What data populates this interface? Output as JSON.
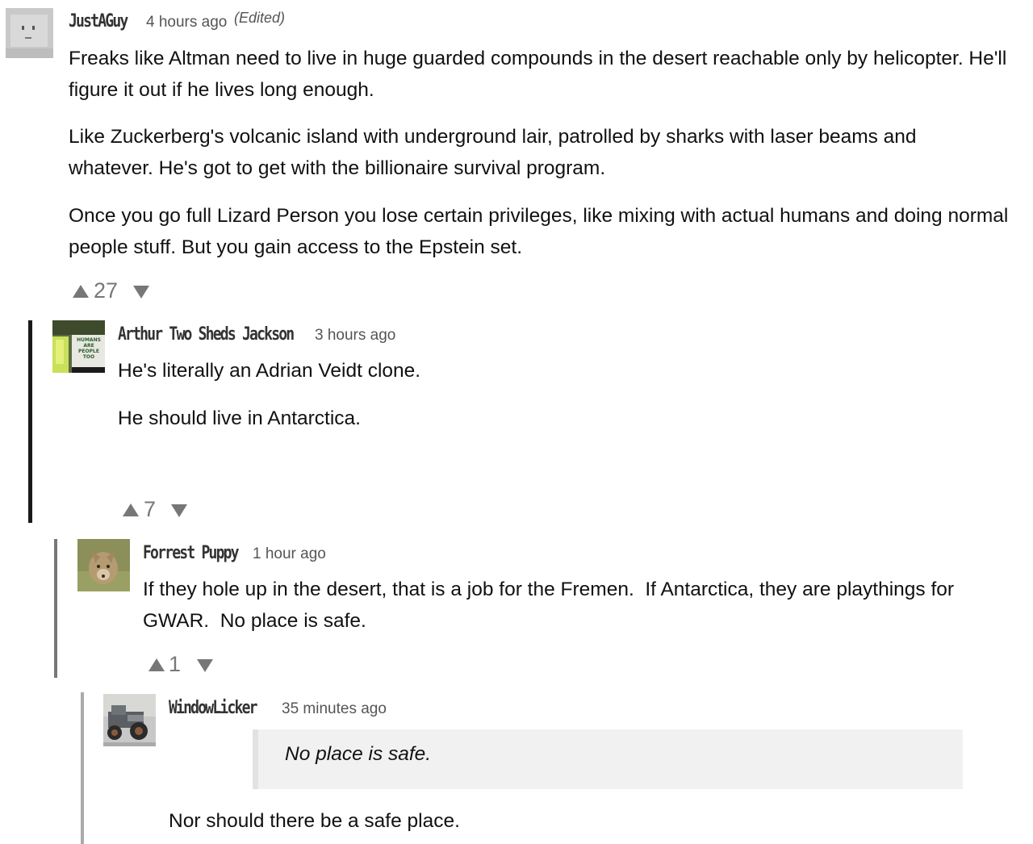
{
  "comments": [
    {
      "username": "JustAGuy",
      "timestamp": "4 hours ago",
      "edited": "(Edited)",
      "avatar_icon": "blocky-robot-avatar-icon",
      "paragraphs": [
        "Freaks like Altman need to live in huge guarded compounds in the desert reachable only by helicopter. He'll figure it out if he lives long enough.",
        "Like Zuckerberg's volcanic island with underground lair, patrolled by sharks with laser beams and whatever. He's got to get with the billionaire survival program.",
        "Once you go full Lizard Person you lose certain privileges, like mixing with actual humans and doing normal people stuff. But you gain access to the Epstein set."
      ],
      "votes": "27"
    },
    {
      "username": "Arthur Two Sheds Jackson",
      "timestamp": "3 hours ago",
      "avatar_icon": "protest-sign-photo-avatar-icon",
      "avatar_sign_text": "HUMANS ARE PEOPLE TOO",
      "paragraphs": [
        "He's literally an Adrian Veidt clone.",
        "He should live in Antarctica."
      ],
      "votes": "7"
    },
    {
      "username": "Forrest Puppy",
      "timestamp": "1 hour ago",
      "avatar_icon": "coyote-photo-avatar-icon",
      "paragraphs": [
        "If they hole up in the desert, that is a job for the Fremen.  If Antarctica, they are playthings for GWAR.  No place is safe."
      ],
      "votes": "1"
    },
    {
      "username": "WindowLicker",
      "timestamp": "35 minutes ago",
      "avatar_icon": "hot-rod-car-avatar-icon",
      "quote": "No place is safe.",
      "paragraphs": [
        "Nor should there be a safe place."
      ]
    }
  ],
  "colors": {
    "thread_line_level1": "#1a1a1a",
    "thread_line_level2": "#777777",
    "thread_line_level3": "#aaaaaa",
    "vote_arrow": "#777777"
  }
}
